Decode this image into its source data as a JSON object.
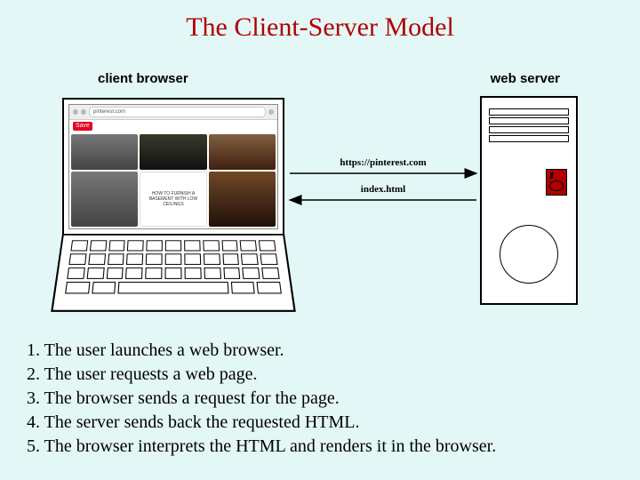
{
  "title": "The Client-Server Model",
  "labels": {
    "client": "client browser",
    "server": "web server"
  },
  "browser": {
    "address": "pinterest.com",
    "save_label": "Save",
    "card_text": "HOW TO FURNISH A BASEMENT WITH LOW CEILINGS"
  },
  "arrows": {
    "request": "https://pinterest.com",
    "response": "index.html"
  },
  "steps": [
    "1. The user launches a web browser.",
    "2. The user requests a web page.",
    "3. The browser sends a request for the page.",
    "4. The server sends back the requested HTML.",
    "5. The browser interprets the HTML and renders it in the browser."
  ]
}
